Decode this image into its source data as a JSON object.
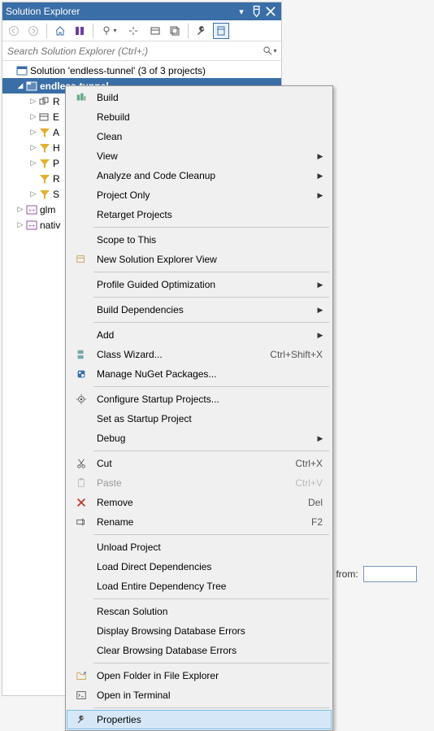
{
  "panel": {
    "title": "Solution Explorer"
  },
  "search": {
    "placeholder": "Search Solution Explorer (Ctrl+;)"
  },
  "tree": {
    "solution": "Solution 'endless-tunnel' (3 of 3 projects)",
    "project": "endless-tunnel",
    "items": [
      "R",
      "E",
      "A",
      "H",
      "P",
      "R",
      "S"
    ],
    "extras": [
      "glm",
      "nativ"
    ]
  },
  "bg": {
    "label": "ut from:"
  },
  "menu": {
    "build": "Build",
    "rebuild": "Rebuild",
    "clean": "Clean",
    "view": "View",
    "analyze": "Analyze and Code Cleanup",
    "project_only": "Project Only",
    "retarget": "Retarget Projects",
    "scope": "Scope to This",
    "new_solexp": "New Solution Explorer View",
    "pgo": "Profile Guided Optimization",
    "build_deps": "Build Dependencies",
    "add": "Add",
    "class_wizard": "Class Wizard...",
    "class_wizard_sc": "Ctrl+Shift+X",
    "nuget": "Manage NuGet Packages...",
    "cfg_startup": "Configure Startup Projects...",
    "set_startup": "Set as Startup Project",
    "debug": "Debug",
    "cut": "Cut",
    "cut_sc": "Ctrl+X",
    "paste": "Paste",
    "paste_sc": "Ctrl+V",
    "remove": "Remove",
    "remove_sc": "Del",
    "rename": "Rename",
    "rename_sc": "F2",
    "unload": "Unload Project",
    "load_direct": "Load Direct Dependencies",
    "load_tree": "Load Entire Dependency Tree",
    "rescan": "Rescan Solution",
    "disp_browse": "Display Browsing Database Errors",
    "clear_browse": "Clear Browsing Database Errors",
    "open_folder": "Open Folder in File Explorer",
    "open_term": "Open in Terminal",
    "properties": "Properties"
  }
}
